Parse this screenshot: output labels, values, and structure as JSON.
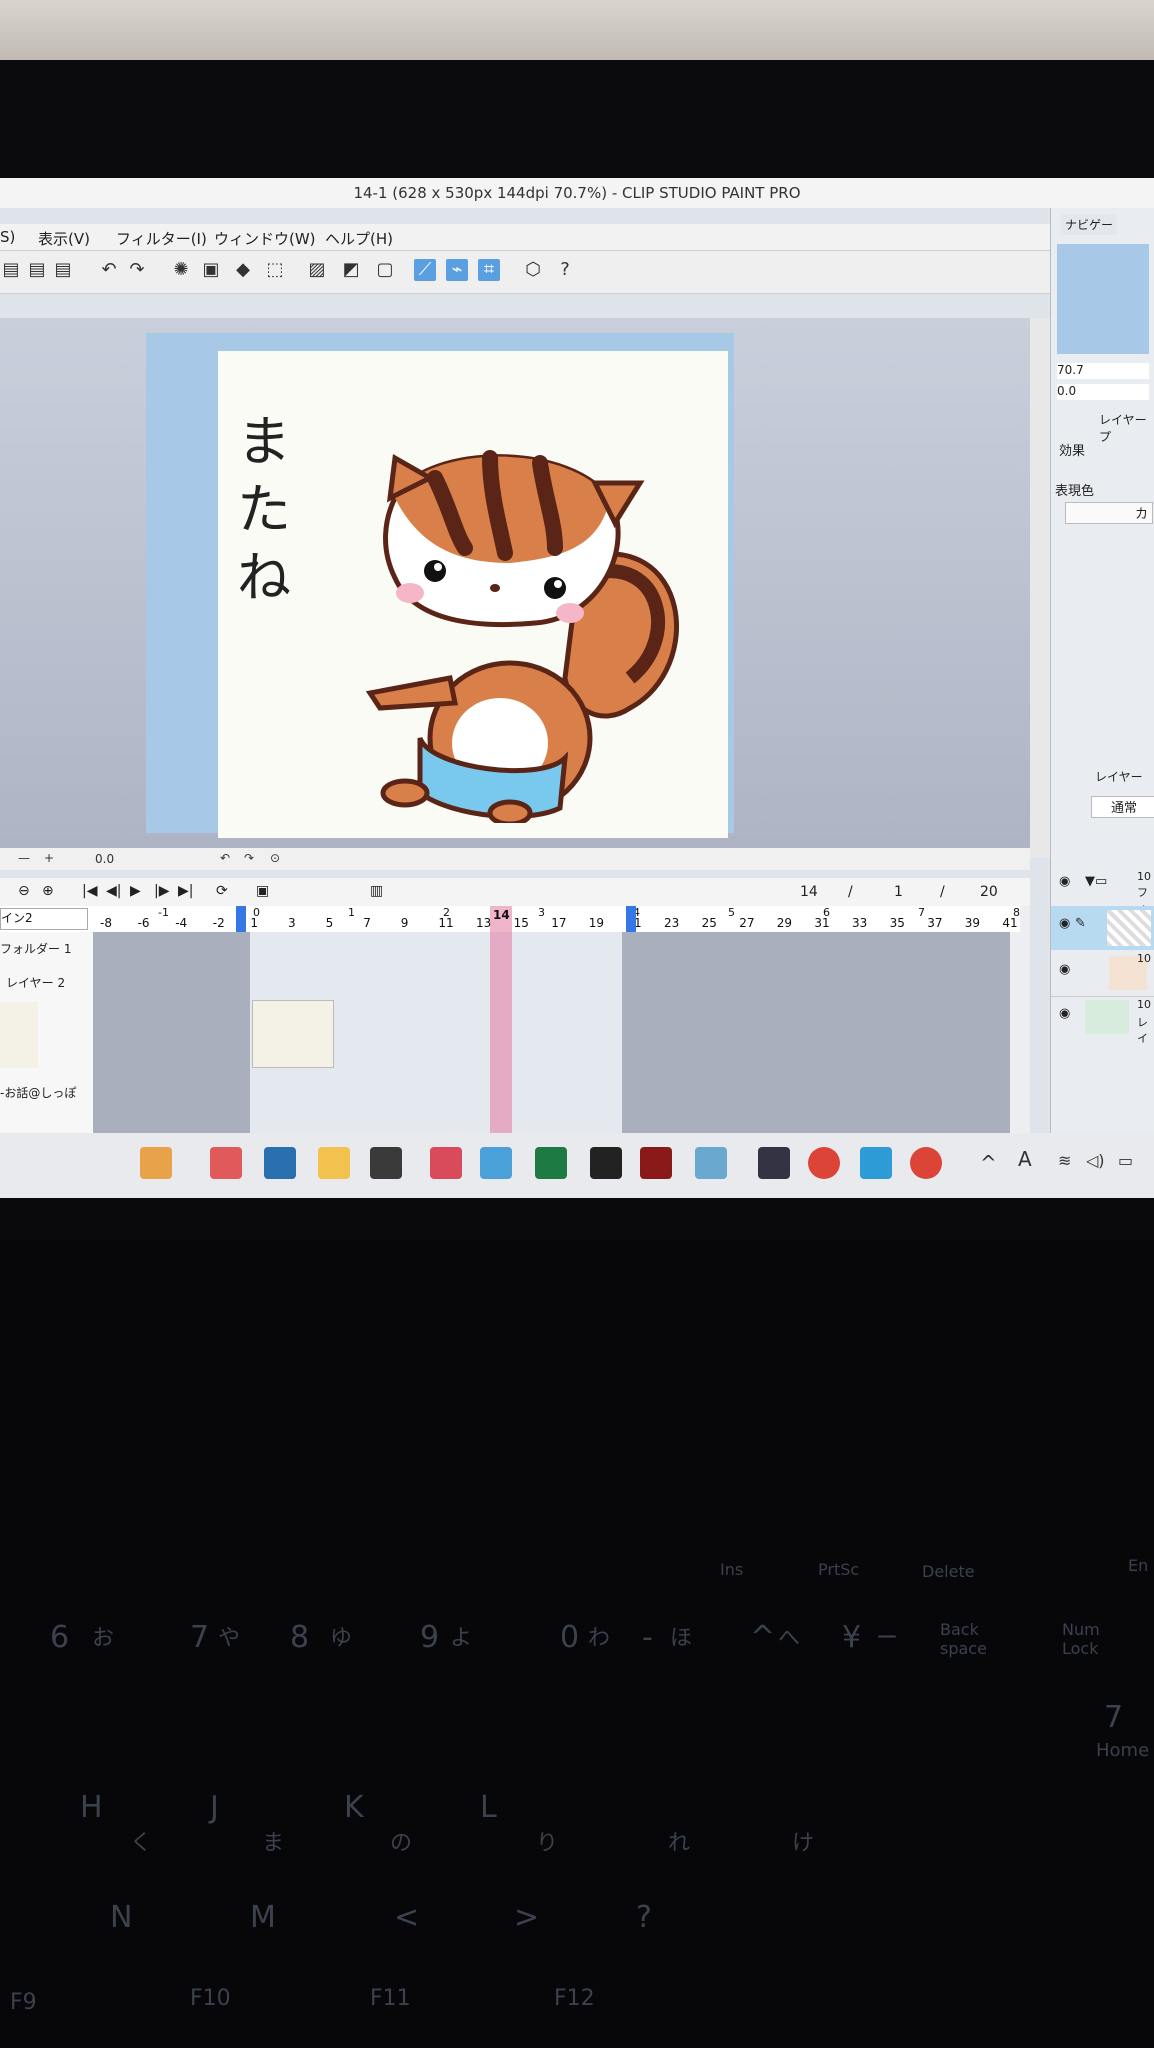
{
  "window": {
    "title": "14-1 (628 x 530px 144dpi 70.7%) - CLIP STUDIO PAINT PRO"
  },
  "menu": {
    "items": [
      "S)",
      "表示(V)",
      "フィルター(I)",
      "ウィンドウ(W)",
      "ヘルプ(H)"
    ]
  },
  "canvas": {
    "handwriting": [
      "ま",
      "た",
      "ね"
    ]
  },
  "right_panel": {
    "navigator_tab": "ナビゲー",
    "zoom_value": "70.7",
    "rotate_value": "0.0",
    "layer_prop_tab": "レイヤープ",
    "effect_label": "効果",
    "expression_label": "表現色",
    "color_button": "カ",
    "layer_tab": "レイヤー",
    "blend_mode": "通常",
    "layers": [
      {
        "name": "10",
        "sub": "フォ"
      },
      {
        "name": "",
        "sub": ""
      },
      {
        "name": "10",
        "sub": ""
      },
      {
        "name": "10",
        "sub": "レイ"
      }
    ]
  },
  "canvas_bar": {
    "rotation": "0.0"
  },
  "timeline": {
    "frame_counter": {
      "current": "14",
      "sep1": "/",
      "start": "1",
      "sep2": "/",
      "end": "20"
    },
    "selector": "イン2",
    "ruler_numbers": [
      "-8",
      "-6",
      "-4",
      "-2",
      "1",
      "3",
      "5",
      "7",
      "9",
      "11",
      "13",
      "15",
      "17",
      "19",
      "21",
      "23",
      "25",
      "27",
      "29",
      "31",
      "33",
      "35",
      "37",
      "39",
      "41"
    ],
    "ruler_seconds": [
      "-1",
      "0",
      "1",
      "2",
      "3",
      "4",
      "5",
      "6",
      "7",
      "8"
    ],
    "current_frame": "14",
    "tracks": [
      "フォルダー 1",
      "レイヤー 2",
      "-お話@しっぽ"
    ]
  },
  "taskbar": {
    "apps": [
      "fruits-app",
      "clip-studio-icon",
      "keyboard-app",
      "file-explorer",
      "sticky-notes",
      "clip-studio-icon-2",
      "notepad",
      "excel",
      "vectorworks",
      "voice-meister",
      "network-app",
      "help-app",
      "chrome",
      "clip-studio-icon-3",
      "chrome-2"
    ],
    "tray_text": "A"
  },
  "keyboard": {
    "row1": [
      "Ins",
      "PrtSc",
      "Delete",
      "En"
    ],
    "row2": [
      "6",
      "お",
      "7",
      "や",
      "8",
      "ゆ",
      "9",
      "よ",
      "0",
      "わ",
      "-",
      "ほ",
      "^",
      "へ",
      "¥",
      "ー",
      "Back space",
      "Num Lock"
    ],
    "row3": [
      "7",
      "Home"
    ],
    "row4": [
      "H",
      "く",
      "J",
      "ま",
      "K",
      "の",
      "L",
      "り",
      "れ",
      "け"
    ],
    "row5": [
      "N",
      "M",
      "<",
      ">",
      "?"
    ],
    "row6": [
      "F9",
      "F10",
      "F11",
      "F12"
    ]
  },
  "colors": {
    "accent_blue": "#3578e5",
    "playhead_pink": "#e678a0",
    "squirrel_orange": "#d9804a",
    "squirrel_dark": "#5a2516",
    "shorts_blue": "#79c8ee"
  }
}
